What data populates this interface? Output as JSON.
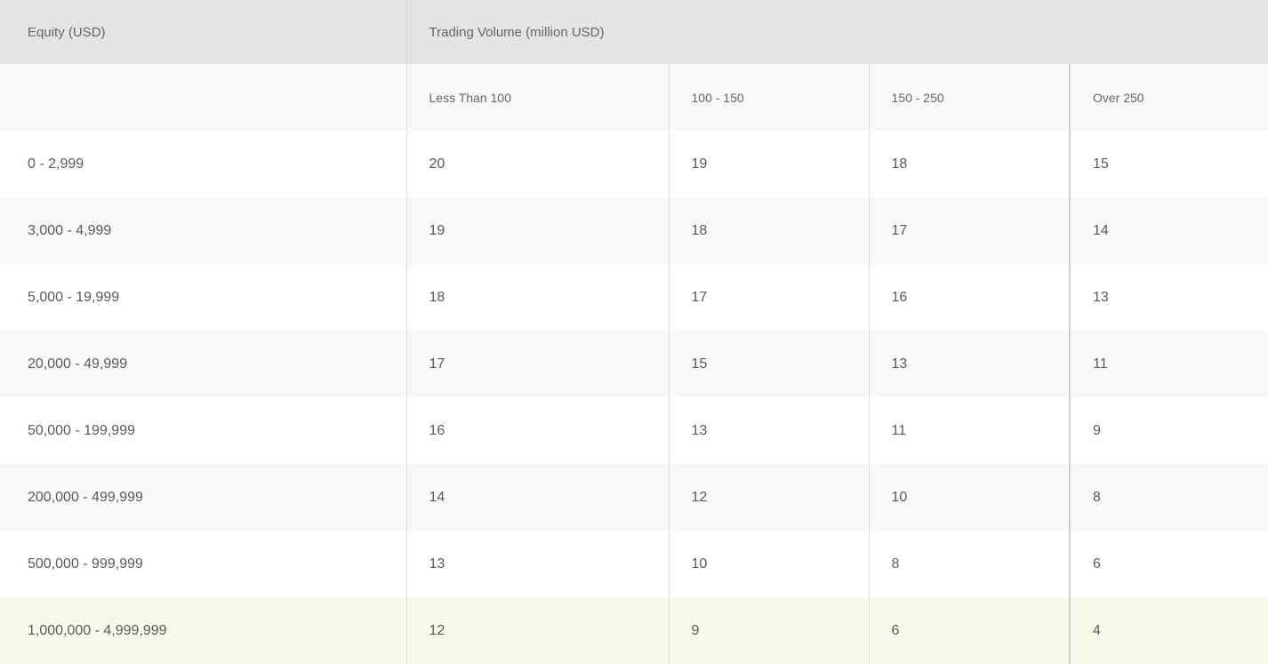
{
  "header": {
    "equity_label": "Equity (USD)",
    "volume_label": "Trading Volume (million USD)"
  },
  "volume_columns": [
    "Less Than 100",
    "100 - 150",
    "150 - 250",
    "Over 250"
  ],
  "rows": [
    {
      "equity": "0 - 2,999",
      "values": [
        "20",
        "19",
        "18",
        "15"
      ]
    },
    {
      "equity": "3,000 - 4,999",
      "values": [
        "19",
        "18",
        "17",
        "14"
      ]
    },
    {
      "equity": "5,000 - 19,999",
      "values": [
        "18",
        "17",
        "16",
        "13"
      ]
    },
    {
      "equity": "20,000 - 49,999",
      "values": [
        "17",
        "15",
        "13",
        "11"
      ]
    },
    {
      "equity": "50,000 - 199,999",
      "values": [
        "16",
        "13",
        "11",
        "9"
      ]
    },
    {
      "equity": "200,000 - 499,999",
      "values": [
        "14",
        "12",
        "10",
        "8"
      ]
    },
    {
      "equity": "500,000 - 999,999",
      "values": [
        "13",
        "10",
        "8",
        "6"
      ]
    },
    {
      "equity": "1,000,000 - 4,999,999",
      "values": [
        "12",
        "9",
        "6",
        "4"
      ]
    }
  ],
  "colors": {
    "header_bg": "#e4e4e4",
    "subheader_bg": "#f8f8f8",
    "row_alt_bg": "#f8f8f8",
    "highlight_row_bg": "#f7f9ea"
  }
}
